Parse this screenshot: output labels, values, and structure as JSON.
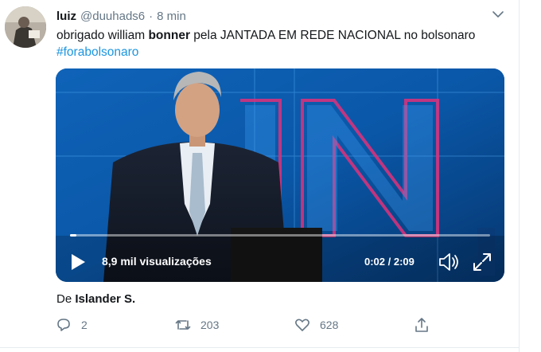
{
  "tweet": {
    "display_name": "luiz",
    "handle": "@duuhads6",
    "separator": "·",
    "time": "8 min",
    "text": {
      "part1": "obrigado william ",
      "bold": "bonner",
      "part2": " pela JANTADA EM REDE NACIONAL  no bolsonaro ",
      "hashtag": "#forabolsonaro"
    },
    "icons": {
      "caret": "chevron-down-icon",
      "avatar": "user-avatar"
    }
  },
  "video": {
    "views": "8,9 mil visualizações",
    "time_readout": "0:02 / 2:09",
    "progress": 0.016,
    "icons": {
      "play": "play-icon",
      "volume": "volume-icon",
      "fullscreen": "fullscreen-icon"
    }
  },
  "source": {
    "prefix": "De",
    "name": "Islander S."
  },
  "actions": {
    "reply_count": "2",
    "retweet_count": "203",
    "like_count": "628",
    "icons": [
      "reply-icon",
      "retweet-icon",
      "like-icon",
      "share-icon"
    ]
  },
  "colors": {
    "text": "#14171a",
    "secondary": "#657786",
    "link": "#1b95e0",
    "divider": "#e6ecf0"
  }
}
